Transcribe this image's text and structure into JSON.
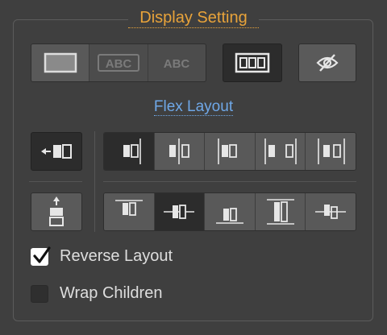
{
  "display_setting": {
    "title": "Display Setting",
    "modes": [
      {
        "icon": "block-icon",
        "active": false
      },
      {
        "icon": "inline-block-abc-icon",
        "label": "ABC",
        "active": false
      },
      {
        "icon": "inline-abc-icon",
        "label": "ABC",
        "active": false
      },
      {
        "icon": "flex-columns-icon",
        "active": true
      },
      {
        "icon": "eye-slash-icon",
        "active": false
      }
    ]
  },
  "flex_layout": {
    "title": "Flex Layout",
    "direction": {
      "row_icon": "row-direction-icon",
      "column_icon": "column-direction-icon"
    },
    "justify": [
      "justify-start-icon",
      "justify-center-icon",
      "justify-end-icon",
      "justify-space-between-icon",
      "justify-space-around-icon"
    ],
    "align": [
      "align-start-icon",
      "align-center-icon",
      "align-end-icon",
      "align-stretch-icon",
      "align-baseline-icon"
    ],
    "reverse_label": "Reverse Layout",
    "reverse_checked": true,
    "wrap_label": "Wrap Children",
    "wrap_checked": false
  }
}
